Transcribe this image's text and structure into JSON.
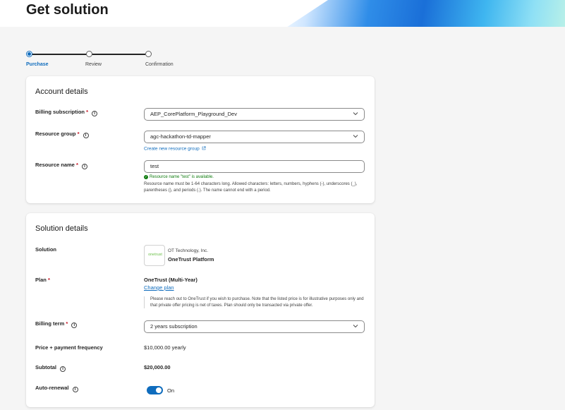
{
  "page": {
    "title": "Get solution"
  },
  "stepper": {
    "steps": [
      {
        "label": "Purchase",
        "active": true
      },
      {
        "label": "Review",
        "active": false
      },
      {
        "label": "Confirmation",
        "active": false
      }
    ]
  },
  "account": {
    "heading": "Account details",
    "billing_subscription": {
      "label": "Billing subscription",
      "value": "AEP_CorePlatform_Playground_Dev"
    },
    "resource_group": {
      "label": "Resource group",
      "value": "agc-hackathon-td-mapper",
      "create_link": "Create new resource group"
    },
    "resource_name": {
      "label": "Resource name",
      "value": "test",
      "status": "Resource name \"test\" is available.",
      "hint": "Resource name must be 1-64 characters long. Allowed characters: letters, numbers, hyphens (-), underscores (_), parentheses (), and periods (.). The name cannot end with a period."
    }
  },
  "solution": {
    "heading": "Solution details",
    "solution_label": "Solution",
    "logo_text": "onetrust",
    "publisher": "OT Technology, Inc.",
    "name": "OneTrust Platform",
    "plan_label": "Plan",
    "plan_name": "OneTrust (Multi-Year)",
    "change_plan": "Change plan",
    "plan_note": "Please reach out to OneTrust if you wish to purchase. Note that the listed price is for illustrative purposes only and that private offer pricing is net of taxes. Plan should only be transacted via private offer.",
    "billing_term_label": "Billing term",
    "billing_term_value": "2 years subscription",
    "price_label": "Price + payment frequency",
    "price_value": "$10,000.00 yearly",
    "subtotal_label": "Subtotal",
    "subtotal_value": "$20,000.00",
    "auto_renewal_label": "Auto-renewal",
    "auto_renewal_value": "On"
  },
  "colors": {
    "accent": "#0f6cbd",
    "success": "#107c10",
    "required": "#c50f1f"
  },
  "icons": {
    "info": "info-icon",
    "chevron": "chevron-down-icon",
    "external": "external-link-icon",
    "check": "check-circle-icon"
  }
}
